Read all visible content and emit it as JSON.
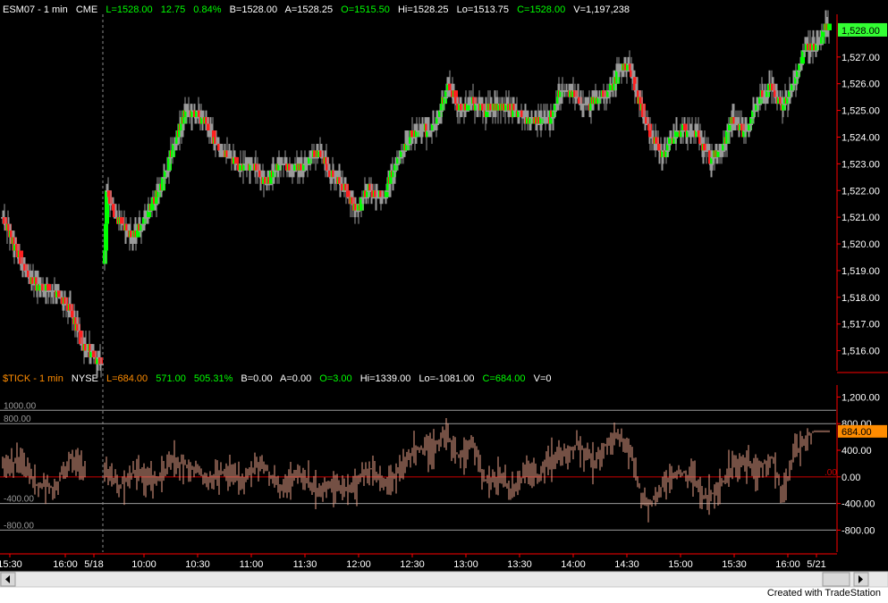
{
  "colors": {
    "background": "#000000",
    "up_bar": "#00ff00",
    "down_bar": "#ff2020",
    "doji_bar": "#9a9a9a",
    "tick_line": "#e8a088",
    "grid": "#9a9a9a",
    "ref_line": "#cc0000",
    "axis_line": "#ff0000",
    "axis_text": "#ffffff",
    "price_badge": "#33ff33",
    "tick_badge": "#ff8c00",
    "session_divider": "#8a8a8a"
  },
  "price_header": {
    "symbol": "ESM07 - 1 min",
    "exchange": "CME",
    "last": "L=1528.00",
    "net": "12.75",
    "pct": "0.84%",
    "bid": "B=1528.00",
    "ask": "A=1528.25",
    "open": "O=1515.50",
    "high": "Hi=1528.25",
    "low": "Lo=1513.75",
    "close": "C=1528.00",
    "volume": "V=1,197,238"
  },
  "tick_header": {
    "symbol": "$TICK - 1 min",
    "exchange": "NYSE",
    "last": "L=684.00",
    "net": "571.00",
    "pct": "505.31%",
    "bid": "B=0.00",
    "ask": "A=0.00",
    "open": "O=3.00",
    "high": "Hi=1339.00",
    "low": "Lo=-1081.00",
    "close": "C=684.00",
    "volume": "V=0"
  },
  "footer": {
    "credit": "Created with TradeStation"
  },
  "chart_data": [
    {
      "type": "candlestick",
      "name": "ESM07 - 1 min",
      "ylim": [
        1515.25,
        1528.6
      ],
      "y_ticks": [
        "1,527.00",
        "1,526.00",
        "1,525.00",
        "1,524.00",
        "1,523.00",
        "1,522.00",
        "1,521.00",
        "1,520.00",
        "1,519.00",
        "1,518.00",
        "1,517.00",
        "1,516.00"
      ],
      "y_tick_values": [
        1527,
        1526,
        1525,
        1524,
        1523,
        1522,
        1521,
        1520,
        1519,
        1518,
        1517,
        1516
      ],
      "last_value_label": "1,528.00",
      "last_value": 1528.0,
      "anchors": [
        [
          0,
          1521.0
        ],
        [
          12,
          1520.0
        ],
        [
          32,
          1518.6
        ],
        [
          60,
          1518.2
        ],
        [
          75,
          1517.5
        ],
        [
          90,
          1516.2
        ],
        [
          110,
          1515.5
        ],
        [
          116,
          1522.0
        ],
        [
          128,
          1521.0
        ],
        [
          145,
          1520.2
        ],
        [
          160,
          1521.0
        ],
        [
          178,
          1522.2
        ],
        [
          195,
          1524.0
        ],
        [
          205,
          1525.0
        ],
        [
          225,
          1524.7
        ],
        [
          245,
          1523.5
        ],
        [
          265,
          1523.0
        ],
        [
          280,
          1523.0
        ],
        [
          295,
          1522.3
        ],
        [
          310,
          1523.0
        ],
        [
          325,
          1522.8
        ],
        [
          340,
          1523.0
        ],
        [
          355,
          1523.5
        ],
        [
          365,
          1522.7
        ],
        [
          380,
          1522.2
        ],
        [
          395,
          1521.3
        ],
        [
          410,
          1522.0
        ],
        [
          425,
          1521.7
        ],
        [
          440,
          1523.0
        ],
        [
          455,
          1524.0
        ],
        [
          470,
          1524.2
        ],
        [
          485,
          1524.5
        ],
        [
          498,
          1526.0
        ],
        [
          512,
          1525.0
        ],
        [
          525,
          1525.3
        ],
        [
          540,
          1525.0
        ],
        [
          555,
          1525.2
        ],
        [
          570,
          1525.0
        ],
        [
          585,
          1524.8
        ],
        [
          600,
          1524.6
        ],
        [
          615,
          1524.8
        ],
        [
          625,
          1525.8
        ],
        [
          640,
          1525.5
        ],
        [
          655,
          1525.2
        ],
        [
          670,
          1525.5
        ],
        [
          680,
          1525.8
        ],
        [
          690,
          1526.5
        ],
        [
          700,
          1526.7
        ],
        [
          712,
          1525.4
        ],
        [
          720,
          1524.5
        ],
        [
          738,
          1523.3
        ],
        [
          750,
          1524.0
        ],
        [
          762,
          1524.3
        ],
        [
          778,
          1524.1
        ],
        [
          792,
          1523.2
        ],
        [
          805,
          1523.5
        ],
        [
          815,
          1524.6
        ],
        [
          830,
          1524.2
        ],
        [
          848,
          1525.5
        ],
        [
          860,
          1525.8
        ],
        [
          873,
          1525.1
        ],
        [
          885,
          1526.0
        ],
        [
          897,
          1527.4
        ],
        [
          910,
          1527.3
        ],
        [
          920,
          1528.0
        ]
      ]
    },
    {
      "type": "bar",
      "name": "$TICK - 1 min",
      "ylim": [
        -1130,
        1380
      ],
      "y_ticks": [
        "1,200.00",
        "800.00",
        "400.00",
        "0.00",
        "-400.00",
        "-800.00"
      ],
      "y_tick_values": [
        1200,
        800,
        400,
        0,
        -400,
        -800
      ],
      "reference_lines": [
        {
          "label": "1000.00",
          "value": 1000
        },
        {
          "label": "800.00",
          "value": 800
        },
        {
          "label": "-400.00",
          "value": -400
        },
        {
          "label": "-800.00",
          "value": -800
        }
      ],
      "zero_label": ".00",
      "last_value_label": "684.00",
      "last_value": 684.0,
      "anchors": [
        [
          0,
          150
        ],
        [
          20,
          250
        ],
        [
          40,
          -150
        ],
        [
          60,
          -150
        ],
        [
          75,
          300
        ],
        [
          90,
          50
        ],
        [
          110,
          250
        ],
        [
          130,
          -150
        ],
        [
          150,
          100
        ],
        [
          170,
          -100
        ],
        [
          190,
          250
        ],
        [
          210,
          150
        ],
        [
          230,
          -50
        ],
        [
          250,
          100
        ],
        [
          270,
          -50
        ],
        [
          290,
          250
        ],
        [
          310,
          -200
        ],
        [
          330,
          50
        ],
        [
          350,
          -200
        ],
        [
          370,
          -100
        ],
        [
          390,
          -200
        ],
        [
          410,
          150
        ],
        [
          430,
          -100
        ],
        [
          450,
          200
        ],
        [
          465,
          450
        ],
        [
          480,
          380
        ],
        [
          495,
          650
        ],
        [
          510,
          300
        ],
        [
          525,
          500
        ],
        [
          540,
          -50
        ],
        [
          555,
          0
        ],
        [
          570,
          -250
        ],
        [
          585,
          100
        ],
        [
          600,
          0
        ],
        [
          615,
          300
        ],
        [
          630,
          400
        ],
        [
          645,
          500
        ],
        [
          660,
          200
        ],
        [
          675,
          500
        ],
        [
          690,
          600
        ],
        [
          705,
          250
        ],
        [
          715,
          -350
        ],
        [
          725,
          -400
        ],
        [
          740,
          -100
        ],
        [
          755,
          100
        ],
        [
          770,
          0
        ],
        [
          785,
          -300
        ],
        [
          800,
          -200
        ],
        [
          815,
          150
        ],
        [
          830,
          200
        ],
        [
          845,
          100
        ],
        [
          860,
          300
        ],
        [
          872,
          -250
        ],
        [
          885,
          300
        ],
        [
          895,
          550
        ],
        [
          907,
          684
        ]
      ]
    }
  ],
  "x_axis": {
    "ticks": [
      {
        "label": "15:30",
        "slot": 8
      },
      {
        "label": "16:00",
        "slot": 70
      },
      {
        "label": "5/18",
        "slot": 102
      },
      {
        "label": "10:00",
        "slot": 158
      },
      {
        "label": "10:30",
        "slot": 218
      },
      {
        "label": "11:00",
        "slot": 278
      },
      {
        "label": "11:30",
        "slot": 338
      },
      {
        "label": "12:00",
        "slot": 398
      },
      {
        "label": "12:30",
        "slot": 458
      },
      {
        "label": "13:00",
        "slot": 518
      },
      {
        "label": "13:30",
        "slot": 578
      },
      {
        "label": "14:00",
        "slot": 638
      },
      {
        "label": "14:30",
        "slot": 698
      },
      {
        "label": "15:00",
        "slot": 758
      },
      {
        "label": "15:30",
        "slot": 818
      },
      {
        "label": "16:00",
        "slot": 878
      },
      {
        "label": "5/21",
        "slot": 910
      }
    ],
    "session_break_slot": 112
  }
}
